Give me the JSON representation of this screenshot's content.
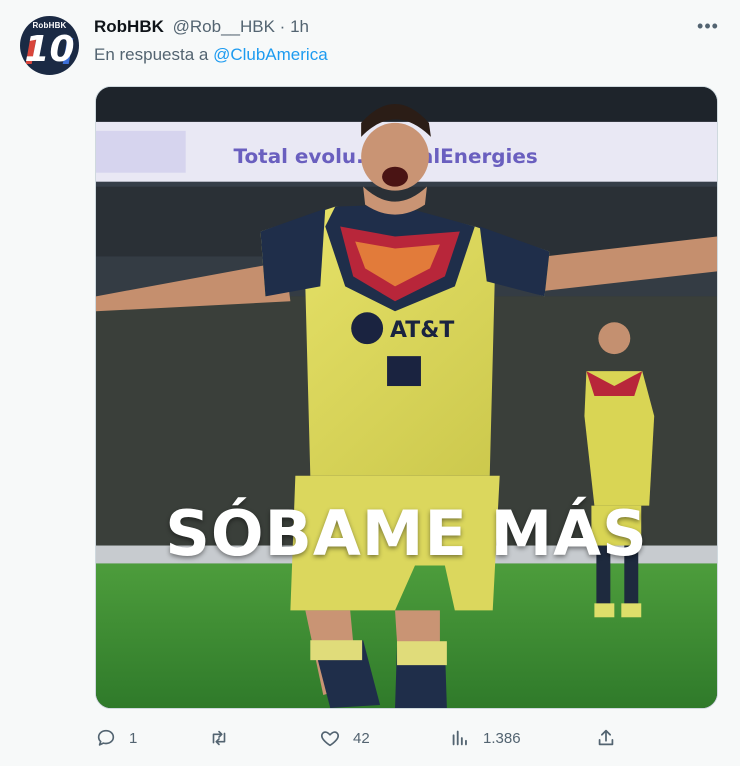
{
  "user": {
    "avatar_tag": "RobHBK",
    "avatar_number": "10",
    "display_name": "RobHBK",
    "handle": "@Rob__HBK",
    "separator": "·",
    "time": "1h"
  },
  "reply": {
    "prefix": "En respuesta a ",
    "mention": "@ClubAmerica"
  },
  "media": {
    "caption": "SÓBAME MÁS",
    "banner_text": "Total evolu...  TotalEnergies",
    "jersey_sponsor": "AT&T"
  },
  "actions": {
    "reply_count": "1",
    "retweet_count": "",
    "like_count": "42",
    "views_count": "1.386"
  },
  "icons": {
    "more": "more-icon",
    "reply": "reply-icon",
    "retweet": "retweet-icon",
    "like": "heart-icon",
    "views": "views-icon",
    "share": "share-icon"
  },
  "colors": {
    "background": "#f7f9f9",
    "text": "#0f1419",
    "secondary": "#536471",
    "link": "#1d9bf0"
  }
}
